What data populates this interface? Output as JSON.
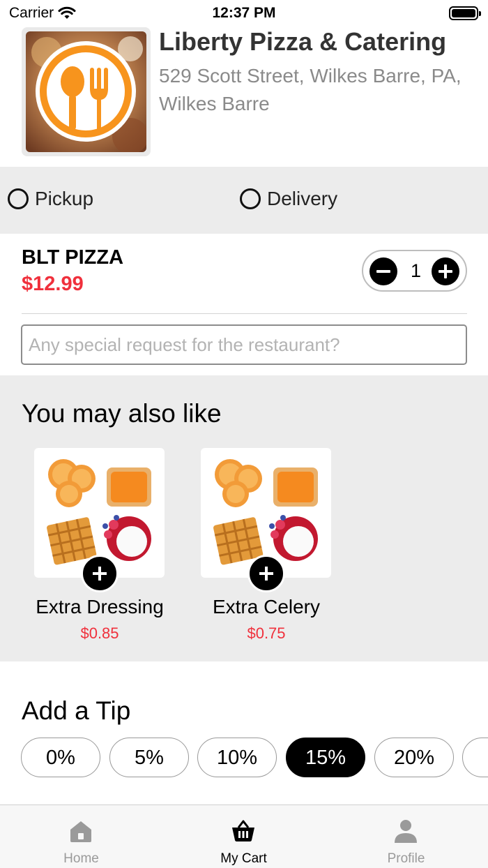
{
  "status_bar": {
    "carrier": "Carrier",
    "time": "12:37 PM"
  },
  "restaurant": {
    "name": "Liberty Pizza & Catering",
    "address": "529 Scott Street, Wilkes Barre, PA, Wilkes Barre"
  },
  "order_type": {
    "options": [
      {
        "label": "Pickup",
        "selected": false
      },
      {
        "label": "Delivery",
        "selected": false
      }
    ]
  },
  "cart_item": {
    "name": "BLT PIZZA",
    "price": "$12.99",
    "quantity": "1",
    "special_request": {
      "value": "",
      "placeholder": "Any special request for the restaurant?"
    }
  },
  "suggestions": {
    "title": "You may also like",
    "items": [
      {
        "name": "Extra Dressing",
        "price": "$0.85"
      },
      {
        "name": "Extra Celery",
        "price": "$0.75"
      }
    ]
  },
  "tip": {
    "title": "Add a Tip",
    "options": [
      "0%",
      "5%",
      "10%",
      "15%",
      "20%"
    ],
    "selected": "15%"
  },
  "tab_bar": {
    "tabs": [
      {
        "label": "Home",
        "icon": "home-icon",
        "active": false
      },
      {
        "label": "My Cart",
        "icon": "basket-icon",
        "active": true
      },
      {
        "label": "Profile",
        "icon": "person-icon",
        "active": false
      }
    ]
  },
  "colors": {
    "price_red": "#f0303c",
    "logo_orange": "#f7941d",
    "selected_chip": "#000000"
  }
}
